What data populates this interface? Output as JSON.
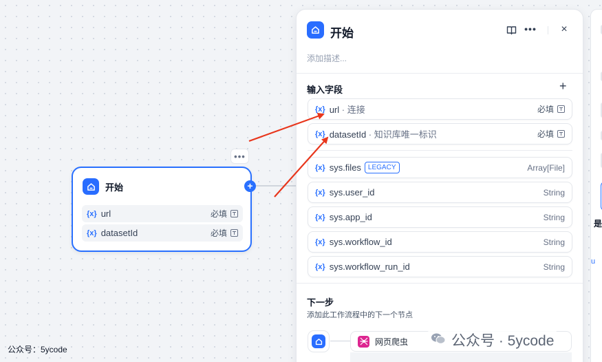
{
  "canvas": {
    "edge_color": "#d0d5dd",
    "start_node": {
      "title": "开始",
      "icon": "home-icon",
      "more_label": "•••",
      "variables": [
        {
          "prefix": "{x}",
          "name": "url",
          "required": "必填"
        },
        {
          "prefix": "{x}",
          "name": "datasetId",
          "required": "必填"
        }
      ],
      "add_handle": "+"
    },
    "watermark": "公众号：5ycode"
  },
  "panel": {
    "title": "开始",
    "icon": "home-icon",
    "description_placeholder": "添加描述...",
    "close_label": "×",
    "more_label": "•••",
    "input_section_title": "输入字段",
    "add_field_label": "+",
    "user_fields": [
      {
        "prefix": "{x}",
        "name": "url",
        "sub": " · 连接",
        "required": "必填"
      },
      {
        "prefix": "{x}",
        "name": "datasetId",
        "sub": " · 知识库唯一标识",
        "required": "必填"
      }
    ],
    "system_fields": [
      {
        "prefix": "{x}",
        "name": "sys.files",
        "badge": "LEGACY",
        "type": "Array[File]"
      },
      {
        "prefix": "{x}",
        "name": "sys.user_id",
        "type": "String"
      },
      {
        "prefix": "{x}",
        "name": "sys.app_id",
        "type": "String"
      },
      {
        "prefix": "{x}",
        "name": "sys.workflow_id",
        "type": "String"
      },
      {
        "prefix": "{x}",
        "name": "sys.workflow_run_id",
        "type": "String"
      }
    ],
    "next_step_title": "下一步",
    "next_step_desc": "添加此工作流程中的下一个节点",
    "next_node_label": "网页爬虫",
    "next_node_icon": "spider-icon"
  },
  "side_peek": {
    "text": "是",
    "text2": "u"
  },
  "overlay_watermark": "公众号 · 5ycode",
  "colors": {
    "accent": "#2970ff",
    "arrow": "#e8361c",
    "crawler": "#dd2590"
  }
}
